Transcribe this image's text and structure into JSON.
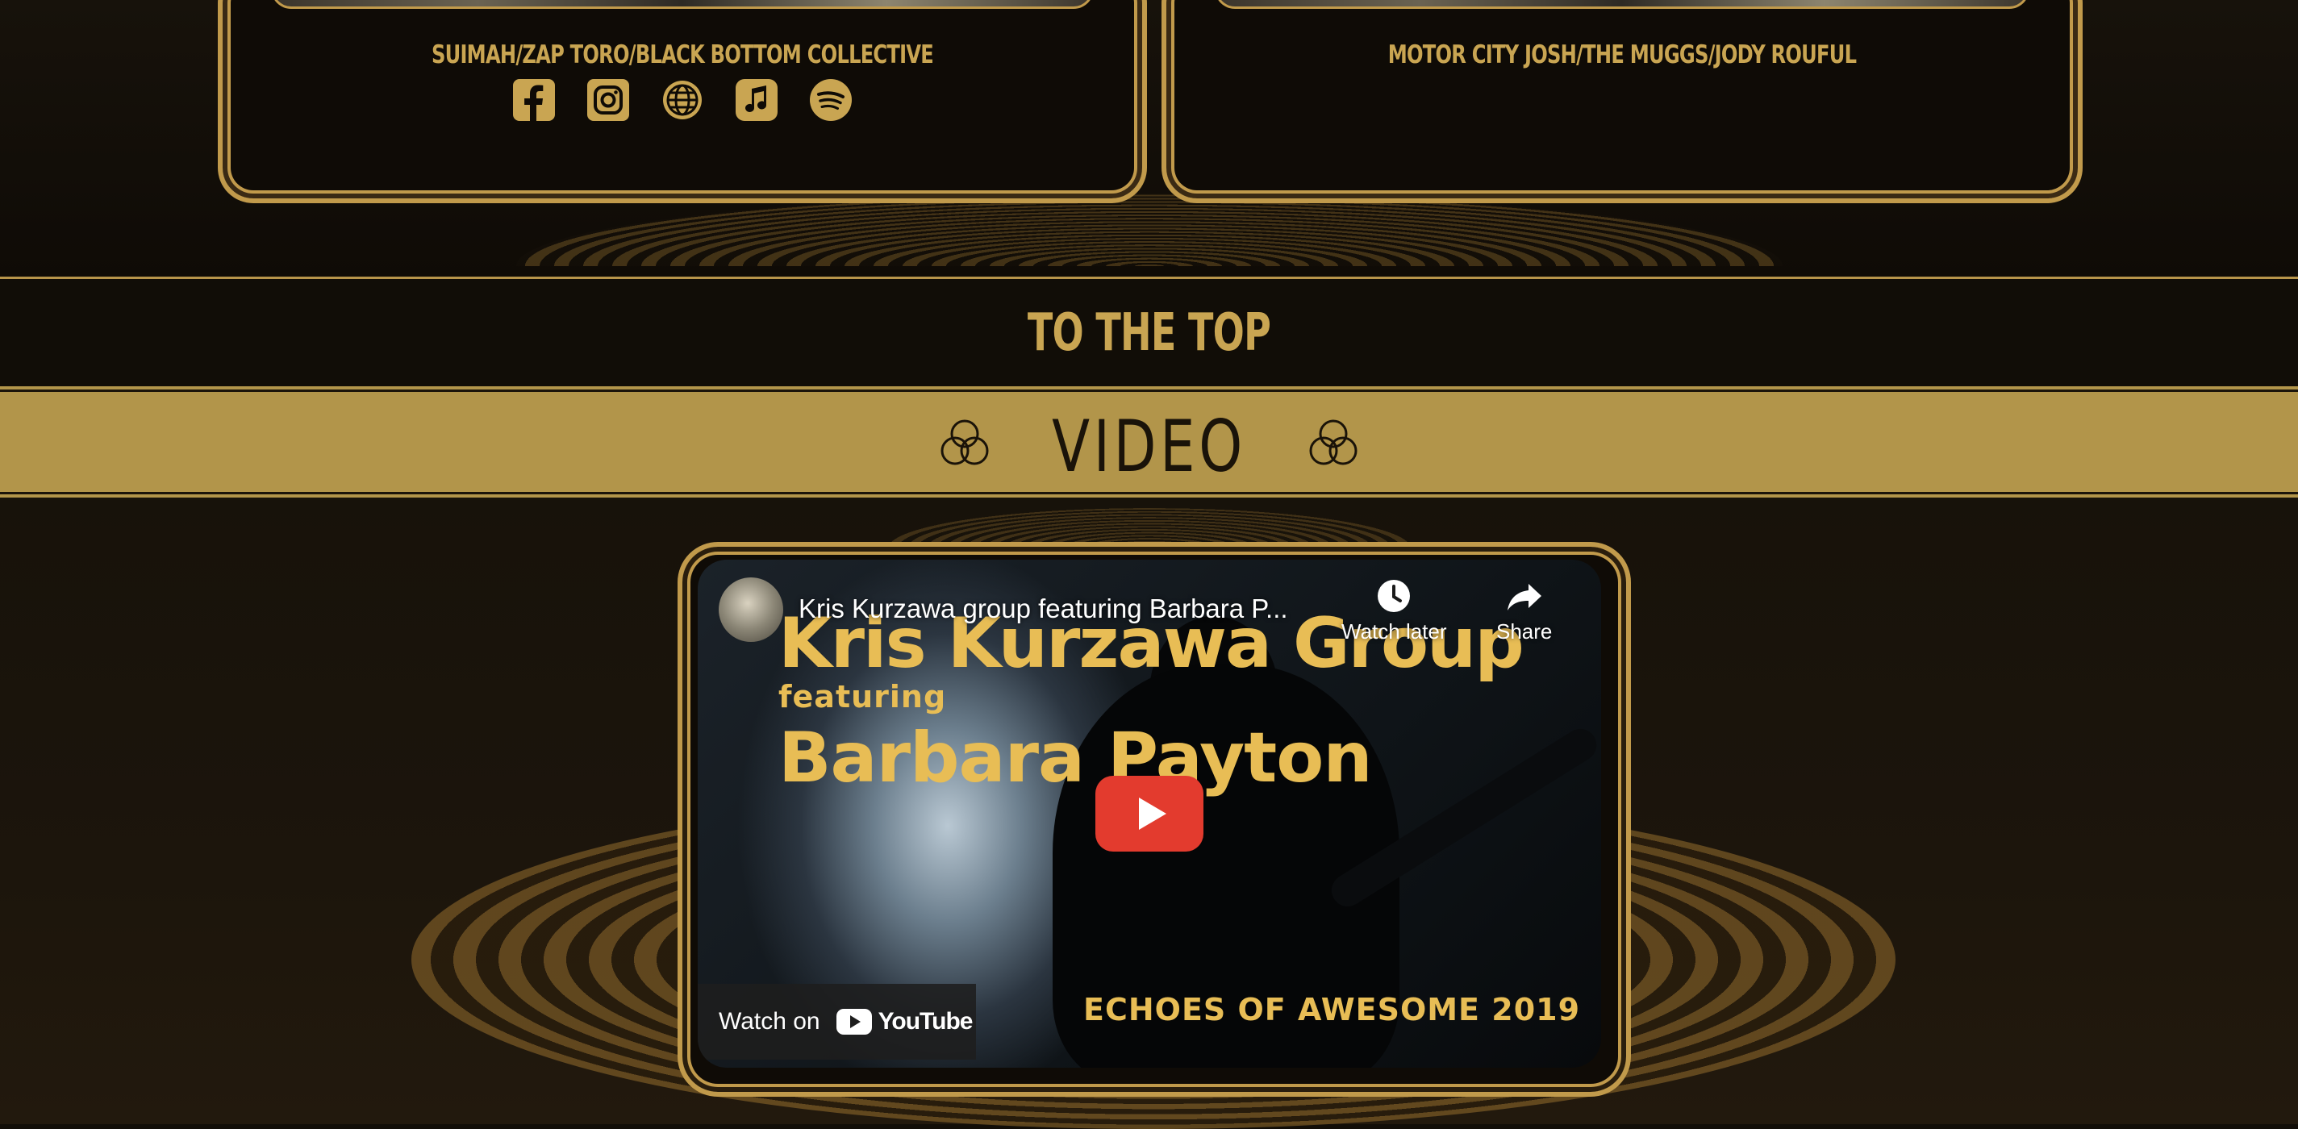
{
  "artist_cards": [
    {
      "name": "SUIMAH/ZAP TORO/BLACK BOTTOM COLLECTIVE",
      "socials": [
        "facebook-icon",
        "instagram-icon",
        "globe-icon",
        "apple-music-icon",
        "spotify-icon"
      ]
    },
    {
      "name": "MOTOR CITY JOSH/THE MUGGS/JODY ROUFUL",
      "socials": []
    }
  ],
  "nav": {
    "to_top": "TO THE TOP"
  },
  "section": {
    "title": "VIDEO"
  },
  "video": {
    "youtube_title": "Kris Kurzawa group featuring Barbara P...",
    "watch_later": "Watch later",
    "share": "Share",
    "watch_on": "Watch on",
    "youtube_brand": "YouTube",
    "thumbnail": {
      "line1": "Kris Kurzawa Group",
      "line2": "featuring",
      "line3": "Barbara Payton",
      "line4": "ECHOES OF AWESOME 2019"
    }
  },
  "colors": {
    "gold": "#c19a4b",
    "banner": "#b2954a",
    "background": "#120e08",
    "youtube_red": "#e33b2e"
  }
}
